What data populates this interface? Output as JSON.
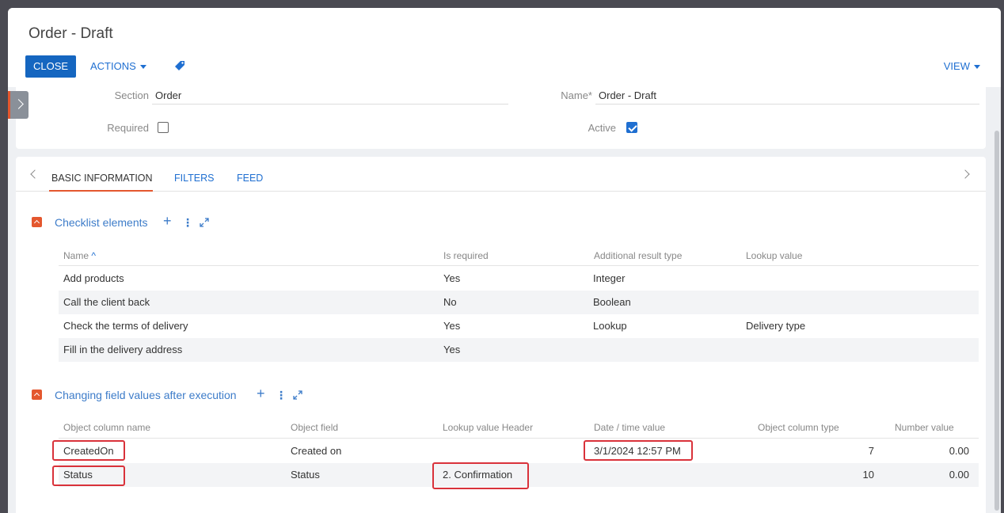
{
  "header": {
    "title": "Order - Draft",
    "close_label": "CLOSE",
    "actions_label": "ACTIONS",
    "view_label": "VIEW"
  },
  "fields": {
    "section_label": "Section",
    "section_value": "Order",
    "name_label": "Name*",
    "name_value": "Order - Draft",
    "required_label": "Required",
    "required_checked": false,
    "active_label": "Active",
    "active_checked": true
  },
  "tabs": [
    {
      "label": "BASIC INFORMATION",
      "active": true
    },
    {
      "label": "FILTERS",
      "active": false
    },
    {
      "label": "FEED",
      "active": false
    }
  ],
  "checklist": {
    "title": "Checklist elements",
    "columns": [
      "Name",
      "Is required",
      "Additional result type",
      "Lookup value"
    ],
    "rows": [
      [
        "Add products",
        "Yes",
        "Integer",
        ""
      ],
      [
        "Call the client back",
        "No",
        "Boolean",
        ""
      ],
      [
        "Check the terms of delivery",
        "Yes",
        "Lookup",
        "Delivery type"
      ],
      [
        "Fill in the delivery address",
        "Yes",
        "",
        ""
      ]
    ]
  },
  "changes": {
    "title": "Changing field values after execution",
    "columns": [
      "Object column name",
      "Object field",
      "Lookup value Header",
      "Date / time value",
      "Object column type",
      "Number value"
    ],
    "rows": [
      [
        "CreatedOn",
        "Created on",
        "",
        "3/1/2024 12:57 PM",
        "7",
        "0.00"
      ],
      [
        "Status",
        "Status",
        "2. Confirmation",
        "",
        "10",
        "0.00"
      ]
    ]
  },
  "colors": {
    "primary": "#1566c0",
    "link": "#1f6fd1",
    "accent": "#e4572e",
    "highlight": "#d9323a"
  }
}
